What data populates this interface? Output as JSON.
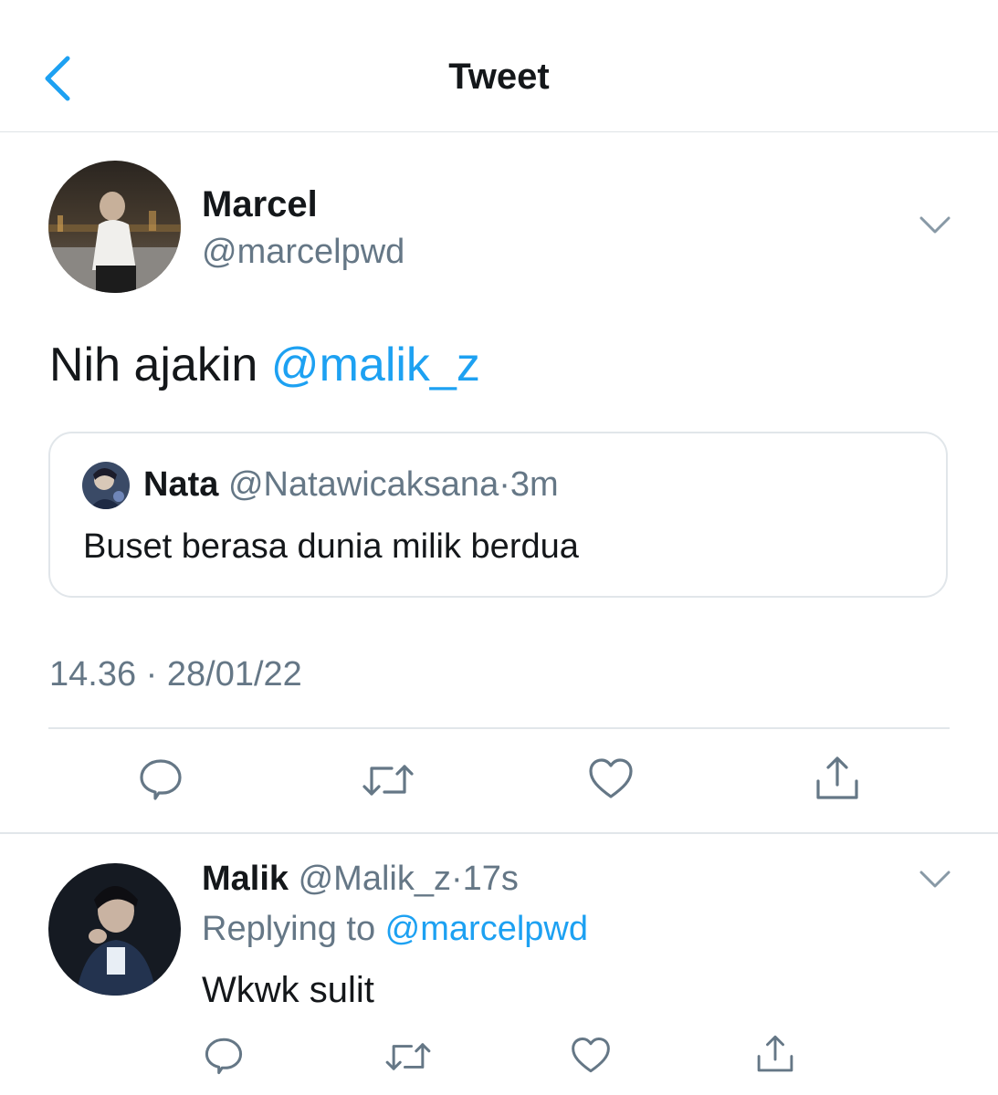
{
  "header": {
    "title": "Tweet",
    "back_icon": "chevron-left-icon"
  },
  "tweet": {
    "author_name": "Marcel",
    "author_handle": "@marcelpwd",
    "text": "Nih ajakin ",
    "mention": "@malik_z",
    "quoted": {
      "author_name": "Nata",
      "author_handle": "@Natawicaksana",
      "dot": "·",
      "time": "3m",
      "text": "Buset berasa dunia milik berdua"
    },
    "time": "14.36",
    "dot": "·",
    "date": "28/01/22"
  },
  "reply": {
    "author_name": "Malik",
    "author_handle": "@Malik_z",
    "dot": "·",
    "time": "17s",
    "replying_label": "Replying to ",
    "replying_handle": "@marcelpwd",
    "text": "Wkwk sulit"
  },
  "icons": {
    "reply": "comment-icon",
    "retweet": "retweet-icon",
    "like": "heart-icon",
    "share": "share-icon",
    "more": "chevron-down-icon"
  },
  "colors": {
    "accent": "#1da1f2",
    "muted": "#657786",
    "text": "#14171a",
    "icon": "#657786"
  }
}
